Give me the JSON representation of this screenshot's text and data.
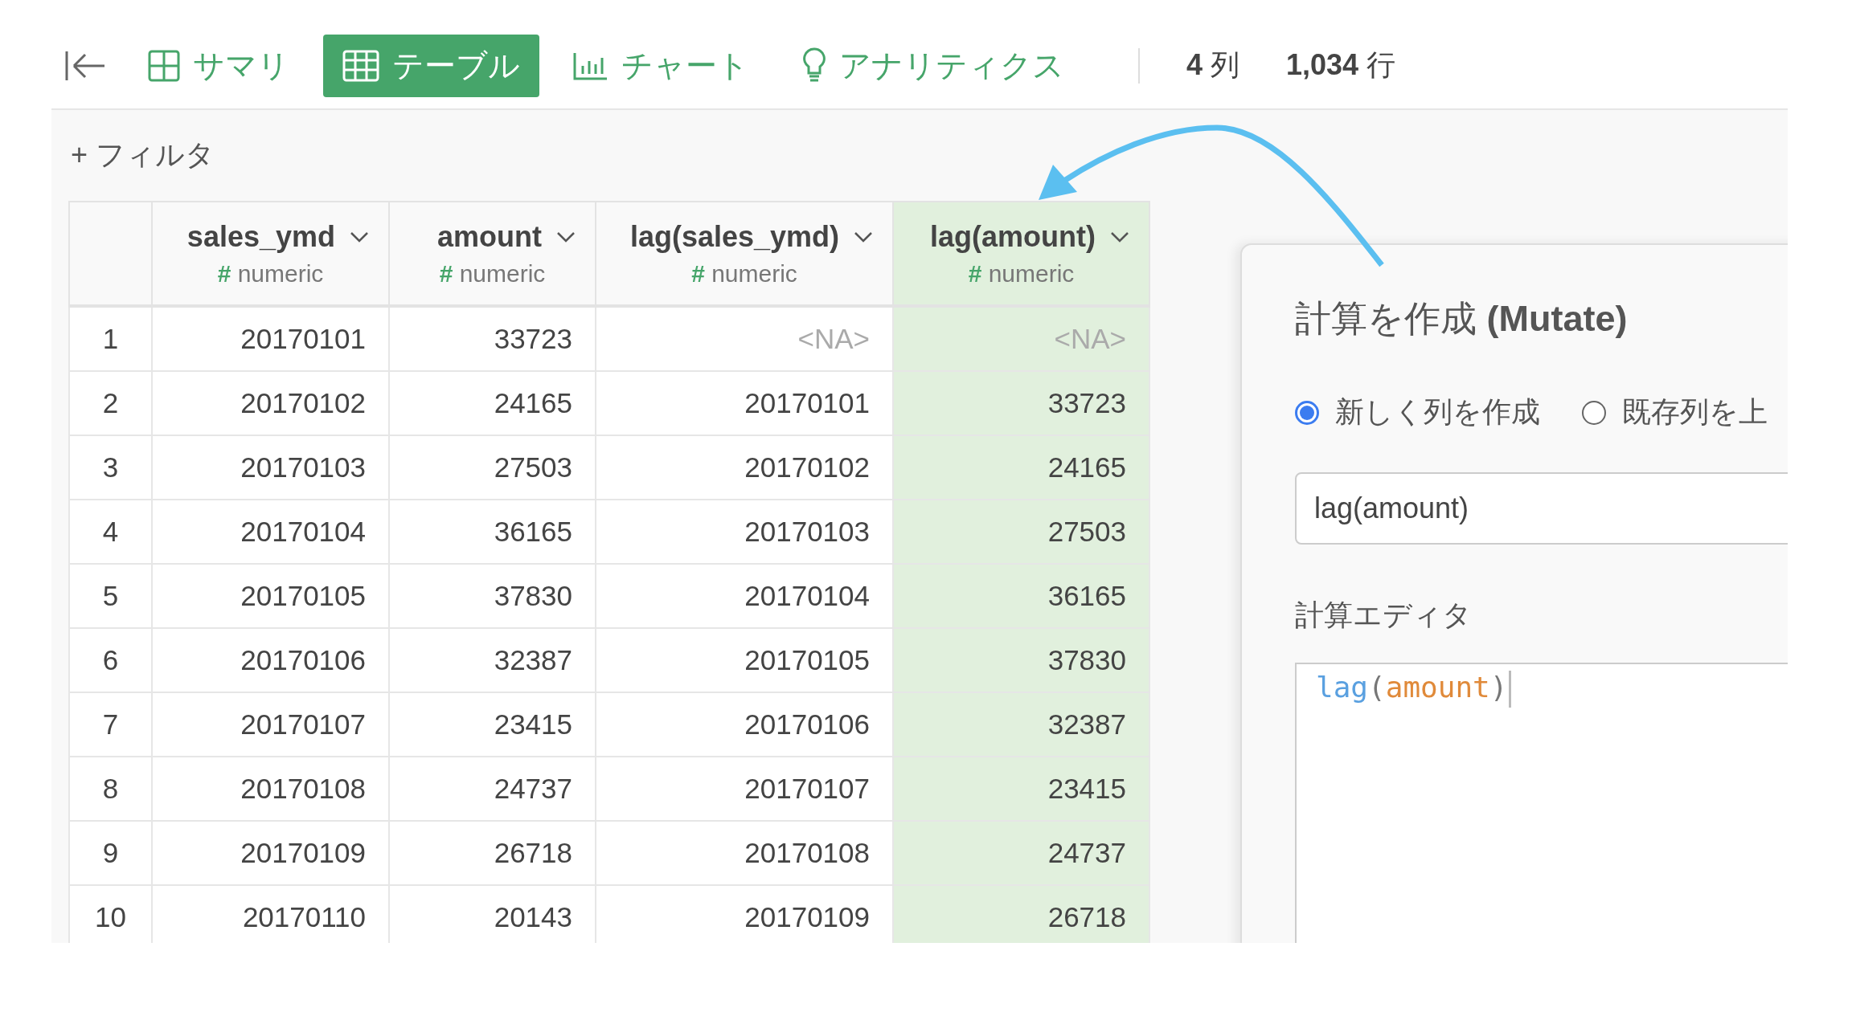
{
  "toolbar": {
    "tabs": [
      {
        "label": "サマリ",
        "kind": "summary",
        "selected": false
      },
      {
        "label": "テーブル",
        "kind": "table",
        "selected": true
      },
      {
        "label": "チャート",
        "kind": "chart",
        "selected": false
      },
      {
        "label": "アナリティクス",
        "kind": "analytics",
        "selected": false
      }
    ],
    "stats": [
      {
        "value": "4",
        "unit": "列"
      },
      {
        "value": "1,034",
        "unit": "行"
      }
    ]
  },
  "filter": {
    "label": "+ フィルタ"
  },
  "table": {
    "columns": [
      {
        "name": "sales_ymd",
        "type_mark": "#",
        "type": "numeric",
        "selected": false
      },
      {
        "name": "amount",
        "type_mark": "#",
        "type": "numeric",
        "selected": false
      },
      {
        "name": "lag(sales_ymd)",
        "type_mark": "#",
        "type": "numeric",
        "selected": false
      },
      {
        "name": "lag(amount)",
        "type_mark": "#",
        "type": "numeric",
        "selected": true
      }
    ],
    "rows": [
      {
        "index": "1",
        "cells": [
          "20170101",
          "33723",
          "<NA>",
          "<NA>"
        ],
        "missing": [
          false,
          false,
          true,
          true
        ]
      },
      {
        "index": "2",
        "cells": [
          "20170102",
          "24165",
          "20170101",
          "33723"
        ],
        "missing": [
          false,
          false,
          false,
          false
        ]
      },
      {
        "index": "3",
        "cells": [
          "20170103",
          "27503",
          "20170102",
          "24165"
        ],
        "missing": [
          false,
          false,
          false,
          false
        ]
      },
      {
        "index": "4",
        "cells": [
          "20170104",
          "36165",
          "20170103",
          "27503"
        ],
        "missing": [
          false,
          false,
          false,
          false
        ]
      },
      {
        "index": "5",
        "cells": [
          "20170105",
          "37830",
          "20170104",
          "36165"
        ],
        "missing": [
          false,
          false,
          false,
          false
        ]
      },
      {
        "index": "6",
        "cells": [
          "20170106",
          "32387",
          "20170105",
          "37830"
        ],
        "missing": [
          false,
          false,
          false,
          false
        ]
      },
      {
        "index": "7",
        "cells": [
          "20170107",
          "23415",
          "20170106",
          "32387"
        ],
        "missing": [
          false,
          false,
          false,
          false
        ]
      },
      {
        "index": "8",
        "cells": [
          "20170108",
          "24737",
          "20170107",
          "23415"
        ],
        "missing": [
          false,
          false,
          false,
          false
        ]
      },
      {
        "index": "9",
        "cells": [
          "20170109",
          "26718",
          "20170108",
          "24737"
        ],
        "missing": [
          false,
          false,
          false,
          false
        ]
      },
      {
        "index": "10",
        "cells": [
          "20170110",
          "20143",
          "20170109",
          "26718"
        ],
        "missing": [
          false,
          false,
          false,
          false
        ]
      }
    ]
  },
  "dialog": {
    "title": "計算を作成",
    "title_bold": "(Mutate)",
    "options": [
      {
        "label": "新しく列を作成",
        "selected": true
      },
      {
        "label": "既存列を上",
        "selected": false
      }
    ],
    "name_field": {
      "value": "lag(amount)"
    },
    "editor_label": "計算エディタ",
    "editor": {
      "tokens": [
        {
          "text": "lag",
          "kind": "function"
        },
        {
          "text": "(",
          "kind": "bracket"
        },
        {
          "text": "amount",
          "kind": "column"
        },
        {
          "text": ")",
          "kind": "bracket"
        }
      ]
    }
  }
}
